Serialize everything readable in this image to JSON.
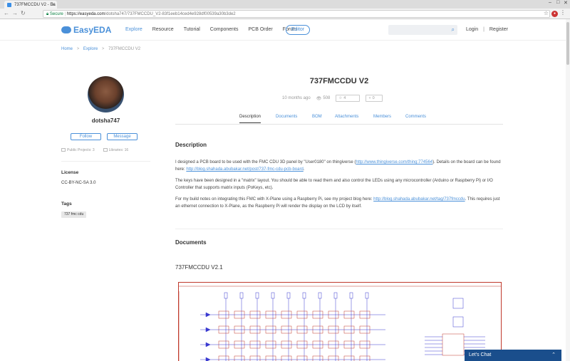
{
  "browser": {
    "tab_title": "737FMCCDU V2 - Ea",
    "secure_label": "Secure",
    "url_host": "https://easyeda.com",
    "url_path": "/dotsha747/737FMCCDU_V2-83f1eeb14ced4e928df00539a30b3de2"
  },
  "header": {
    "logo": "EasyEDA",
    "menu": [
      "Explore",
      "Resource",
      "Tutorial",
      "Components",
      "PCB Order",
      "Forum"
    ],
    "editor": "Editor",
    "login": "Login",
    "sep": "|",
    "register": "Register"
  },
  "breadcrumb": {
    "home": "Home",
    "explore": "Explore",
    "current": "737FMCCDU V2"
  },
  "user": {
    "name": "dotsha747",
    "follow": "Follow",
    "message": "Message",
    "public_projects": "Public Projects: 3",
    "libraries": "Libraries: 16"
  },
  "license": {
    "heading": "License",
    "value": "CC-BY-NC-SA 3.0"
  },
  "tags": {
    "heading": "Tags",
    "items": [
      "737 fmc cdu"
    ]
  },
  "project": {
    "title": "737FMCCDU V2",
    "time": "10 months ago",
    "views": "508",
    "likes": "4",
    "forks": "0",
    "tabs": [
      "Description",
      "Documents",
      "BOM",
      "Attachments",
      "Members",
      "Comments"
    ]
  },
  "description": {
    "heading": "Description",
    "p1_text": "I designed a PCB board to be used with the FMC CDU 3D panel by \"User0180\" on thingiverse (",
    "p1_link1": "http://www.thingiverse.com/thing:774564",
    "p1_mid": "). Details on the board can be found here: ",
    "p1_link2": "http://blog.shahada.abubakar.net/post/737-fmc-cdu-pcb-board",
    "p1_end": ".",
    "p2": "The keys have been designed in a \"matrix\" layout. You should be able to read them and also control the LEDs using any microcontroller (Arduino or Raspberry Pi) or I/O Controller that supports matrix inputs (PoKeys, etc).",
    "p3_text": "For my build notes on integrating this FMC with X-Plane using a Raspberry Pi, see my project blog here: ",
    "p3_link": "http://blog.shahada.abubakar.net/tag/737fmccdu",
    "p3_end": ". This requires just an ethernet connection to X-Plane, as the Raspberry Pi will render the display on the LCD by itself."
  },
  "documents": {
    "heading": "Documents",
    "doc_title": "737FMCCDU V2.1"
  },
  "chat": {
    "label": "Let's Chat"
  },
  "colors": {
    "accent": "#4a90d9",
    "chat_bg": "#1a4e8c",
    "schematic_border": "#c0392b"
  }
}
